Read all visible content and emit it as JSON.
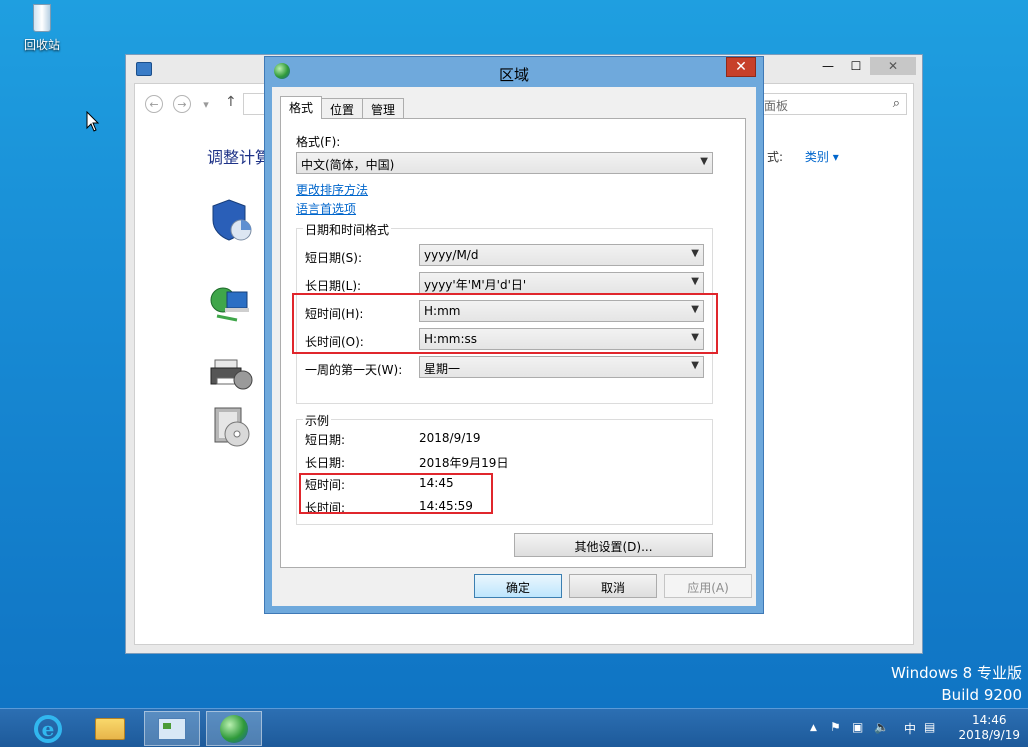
{
  "desktop": {
    "recycle_bin_label": "回收站",
    "watermark_line1": "Windows 8 专业版",
    "watermark_line2": "Build 9200"
  },
  "control_panel": {
    "search_placeholder": "面板",
    "heading": "调整计算",
    "view_by_label": "式:",
    "view_by_value": "类别 ▾",
    "icons": [
      "shield-icon",
      "network-icon",
      "printer-icon",
      "programs-icon"
    ]
  },
  "dialog": {
    "title": "区域",
    "close_glyph": "✕",
    "tabs": [
      {
        "label": "格式",
        "active": true
      },
      {
        "label": "位置",
        "active": false
      },
      {
        "label": "管理",
        "active": false
      }
    ],
    "format_label": "格式(F):",
    "format_value": "中文(简体，中国)",
    "links": {
      "change_sort": "更改排序方法",
      "language_prefs": "语言首选项"
    },
    "datetime_group": {
      "legend": "日期和时间格式",
      "rows": [
        {
          "label": "短日期(S):",
          "value": "yyyy/M/d"
        },
        {
          "label": "长日期(L):",
          "value": "yyyy'年'M'月'd'日'"
        },
        {
          "label": "短时间(H):",
          "value": "H:mm"
        },
        {
          "label": "长时间(O):",
          "value": "H:mm:ss"
        },
        {
          "label": "一周的第一天(W):",
          "value": "星期一"
        }
      ]
    },
    "examples_group": {
      "legend": "示例",
      "rows": [
        {
          "label": "短日期:",
          "value": "2018/9/19"
        },
        {
          "label": "长日期:",
          "value": "2018年9月19日"
        },
        {
          "label": "短时间:",
          "value": "14:45"
        },
        {
          "label": "长时间:",
          "value": "14:45:59"
        }
      ]
    },
    "buttons": {
      "more_settings": "其他设置(D)...",
      "ok": "确定",
      "cancel": "取消",
      "apply": "应用(A)"
    }
  },
  "taskbar": {
    "tray_chevron": "▲",
    "ime": "中",
    "time": "14:46",
    "date": "2018/9/19",
    "apps": [
      "ie-icon",
      "file-explorer-icon",
      "control-panel-icon",
      "region-globe-icon"
    ]
  },
  "colors": {
    "highlight": "#e0262c",
    "link": "#0066cc",
    "dialog_frame": "#6fa9dc",
    "close_button": "#c7402a"
  }
}
